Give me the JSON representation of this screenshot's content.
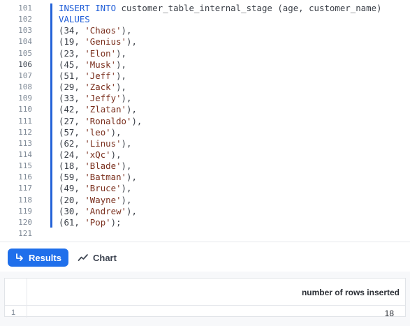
{
  "editor": {
    "lines": [
      {
        "num": "101",
        "parts": [
          {
            "t": "INSERT INTO ",
            "c": "kw"
          },
          {
            "t": "customer_table_internal_stage (age, customer_name)",
            "c": ""
          }
        ]
      },
      {
        "num": "102",
        "parts": [
          {
            "t": "VALUES",
            "c": "kw"
          }
        ]
      },
      {
        "num": "103",
        "parts": [
          {
            "t": "(34, ",
            "c": ""
          },
          {
            "t": "'Chaos'",
            "c": "str"
          },
          {
            "t": "),",
            "c": ""
          }
        ]
      },
      {
        "num": "104",
        "parts": [
          {
            "t": "(19, ",
            "c": ""
          },
          {
            "t": "'Genius'",
            "c": "str"
          },
          {
            "t": "),",
            "c": ""
          }
        ]
      },
      {
        "num": "105",
        "parts": [
          {
            "t": "(23, ",
            "c": ""
          },
          {
            "t": "'Elon'",
            "c": "str"
          },
          {
            "t": "),",
            "c": ""
          }
        ]
      },
      {
        "num": "106",
        "active": true,
        "parts": [
          {
            "t": "(45, ",
            "c": ""
          },
          {
            "t": "'Musk'",
            "c": "str"
          },
          {
            "t": "),",
            "c": ""
          }
        ]
      },
      {
        "num": "107",
        "parts": [
          {
            "t": "(51, ",
            "c": ""
          },
          {
            "t": "'Jeff'",
            "c": "str"
          },
          {
            "t": "),",
            "c": ""
          }
        ]
      },
      {
        "num": "108",
        "parts": [
          {
            "t": "(29, ",
            "c": ""
          },
          {
            "t": "'Zack'",
            "c": "str"
          },
          {
            "t": "),",
            "c": ""
          }
        ]
      },
      {
        "num": "109",
        "parts": [
          {
            "t": "(33, ",
            "c": ""
          },
          {
            "t": "'Jeffy'",
            "c": "str"
          },
          {
            "t": "),",
            "c": ""
          }
        ]
      },
      {
        "num": "110",
        "parts": [
          {
            "t": "(42, ",
            "c": ""
          },
          {
            "t": "'Zlatan'",
            "c": "str"
          },
          {
            "t": "),",
            "c": ""
          }
        ]
      },
      {
        "num": "111",
        "parts": [
          {
            "t": "(27, ",
            "c": ""
          },
          {
            "t": "'Ronaldo'",
            "c": "str"
          },
          {
            "t": "),",
            "c": ""
          }
        ]
      },
      {
        "num": "112",
        "parts": [
          {
            "t": "(57, ",
            "c": ""
          },
          {
            "t": "'leo'",
            "c": "str"
          },
          {
            "t": "),",
            "c": ""
          }
        ]
      },
      {
        "num": "113",
        "parts": [
          {
            "t": "(62, ",
            "c": ""
          },
          {
            "t": "'Linus'",
            "c": "str"
          },
          {
            "t": "),",
            "c": ""
          }
        ]
      },
      {
        "num": "114",
        "parts": [
          {
            "t": "(24, ",
            "c": ""
          },
          {
            "t": "'xQc'",
            "c": "str"
          },
          {
            "t": "),",
            "c": ""
          }
        ]
      },
      {
        "num": "115",
        "parts": [
          {
            "t": "(18, ",
            "c": ""
          },
          {
            "t": "'Blade'",
            "c": "str"
          },
          {
            "t": "),",
            "c": ""
          }
        ]
      },
      {
        "num": "116",
        "parts": [
          {
            "t": "(59, ",
            "c": ""
          },
          {
            "t": "'Batman'",
            "c": "str"
          },
          {
            "t": "),",
            "c": ""
          }
        ]
      },
      {
        "num": "117",
        "parts": [
          {
            "t": "(49, ",
            "c": ""
          },
          {
            "t": "'Bruce'",
            "c": "str"
          },
          {
            "t": "),",
            "c": ""
          }
        ]
      },
      {
        "num": "118",
        "parts": [
          {
            "t": "(20, ",
            "c": ""
          },
          {
            "t": "'Wayne'",
            "c": "str"
          },
          {
            "t": "),",
            "c": ""
          }
        ]
      },
      {
        "num": "119",
        "parts": [
          {
            "t": "(30, ",
            "c": ""
          },
          {
            "t": "'Andrew'",
            "c": "str"
          },
          {
            "t": "),",
            "c": ""
          }
        ]
      },
      {
        "num": "120",
        "parts": [
          {
            "t": "(61, ",
            "c": ""
          },
          {
            "t": "'Pop'",
            "c": "str"
          },
          {
            "t": ");",
            "c": ""
          }
        ]
      },
      {
        "num": "121",
        "parts": []
      }
    ]
  },
  "results_bar": {
    "results_label": "Results",
    "results_icon": "arrow-down-right-icon",
    "chart_label": "Chart",
    "chart_icon": "line-chart-icon"
  },
  "result_table": {
    "columns": [
      "number of rows inserted"
    ],
    "rows": [
      {
        "num": "1",
        "values": [
          "18"
        ]
      }
    ]
  },
  "colors": {
    "accent": "#1f6feb",
    "keyword": "#1c5bd7",
    "string": "#7a2f1d"
  }
}
